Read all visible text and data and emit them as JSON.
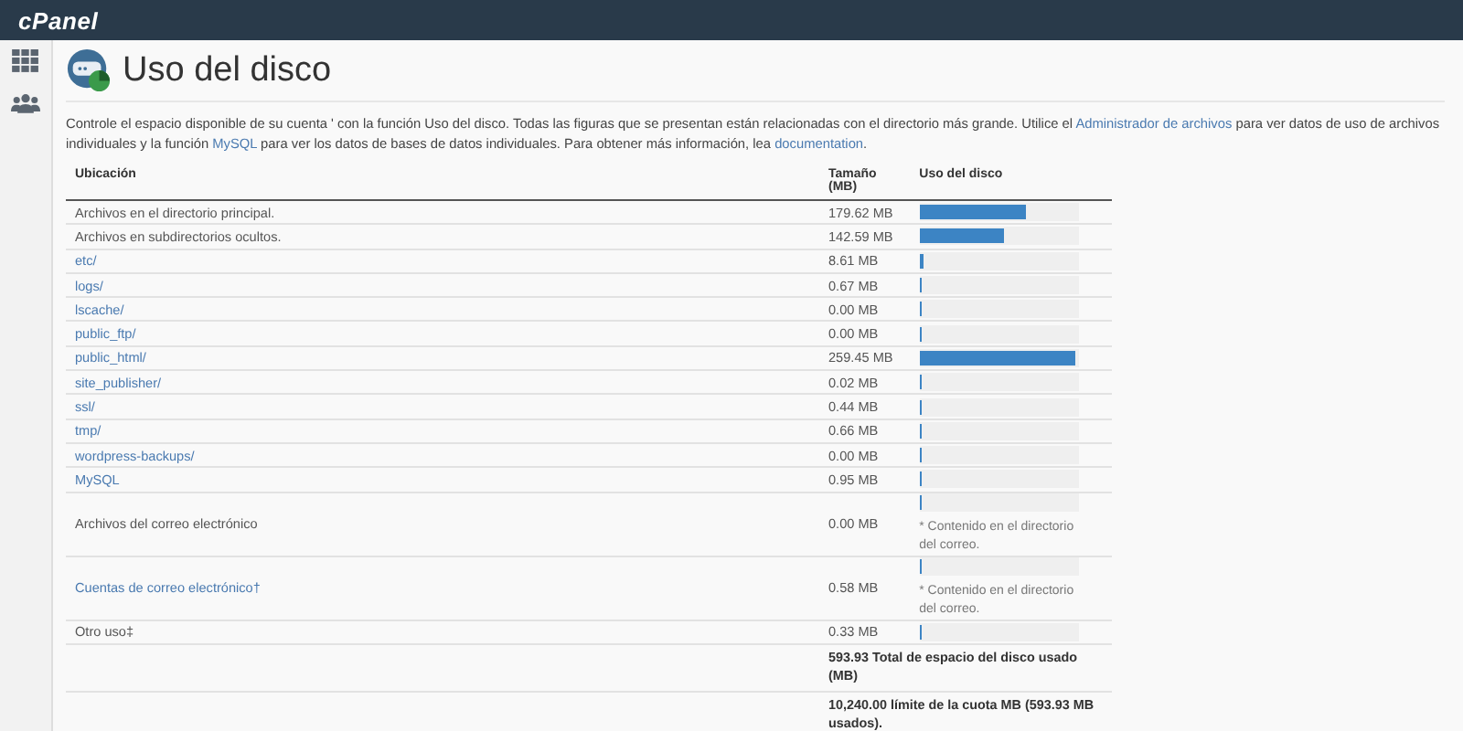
{
  "header": {
    "logo": "cPanel"
  },
  "page": {
    "title": "Uso del disco"
  },
  "description": [
    {
      "kind": "text",
      "text": "Controle el espacio disponible de su cuenta ' con la función Uso del disco. Todas las figuras que se presentan están relacionadas con el directorio más grande. Utilice el "
    },
    {
      "kind": "link",
      "text": "Administrador de archivos"
    },
    {
      "kind": "text",
      "text": " para ver datos de uso de archivos individuales y la función "
    },
    {
      "kind": "link",
      "text": "MySQL"
    },
    {
      "kind": "text",
      "text": " para ver los datos de bases de datos individuales. Para obtener más información, lea "
    },
    {
      "kind": "link",
      "text": "documentation"
    },
    {
      "kind": "text",
      "text": "."
    }
  ],
  "table": {
    "columns": [
      "Ubicación",
      "Tamaño (MB)",
      "Uso del disco"
    ],
    "rows": [
      {
        "kind": "text",
        "location": "Archivos en el directorio principal.",
        "size": "179.62 MB",
        "level": 0.69
      },
      {
        "kind": "text",
        "location": "Archivos en subdirectorios ocultos.",
        "size": "142.59 MB",
        "level": 0.55
      },
      {
        "kind": "link",
        "location": "etc/",
        "size": "8.61 MB",
        "level": 0.03
      },
      {
        "kind": "link",
        "location": "logs/",
        "size": "0.67 MB",
        "level": 0
      },
      {
        "kind": "link",
        "location": "lscache/",
        "size": "0.00 MB",
        "level": 0
      },
      {
        "kind": "link",
        "location": "public_ftp/",
        "size": "0.00 MB",
        "level": 0
      },
      {
        "kind": "link",
        "location": "public_html/",
        "size": "259.45 MB",
        "level": 1
      },
      {
        "kind": "link",
        "location": "site_publisher/",
        "size": "0.02 MB",
        "level": 0
      },
      {
        "kind": "link",
        "location": "ssl/",
        "size": "0.44 MB",
        "level": 0
      },
      {
        "kind": "link",
        "location": "tmp/",
        "size": "0.66 MB",
        "level": 0
      },
      {
        "kind": "link",
        "location": "wordpress-backups/",
        "size": "0.00 MB",
        "level": 0
      },
      {
        "kind": "link",
        "location": "MySQL",
        "size": "0.95 MB",
        "level": 0
      },
      {
        "kind": "text",
        "location": "Archivos del correo electrónico",
        "size": "0.00 MB",
        "level": 0,
        "note": "* Contenido en el directorio del correo."
      },
      {
        "kind": "link",
        "location": "Cuentas de correo electrónico†",
        "size": "0.58 MB",
        "level": 0,
        "note": "* Contenido en el directorio del correo."
      },
      {
        "kind": "text",
        "location": "Otro uso‡",
        "size": "0.33 MB",
        "level": 0
      }
    ],
    "totals": [
      "593.93 Total de espacio del disco usado (MB)",
      "10,240.00 límite de la cuota MB (593.93 MB usados)."
    ]
  }
}
